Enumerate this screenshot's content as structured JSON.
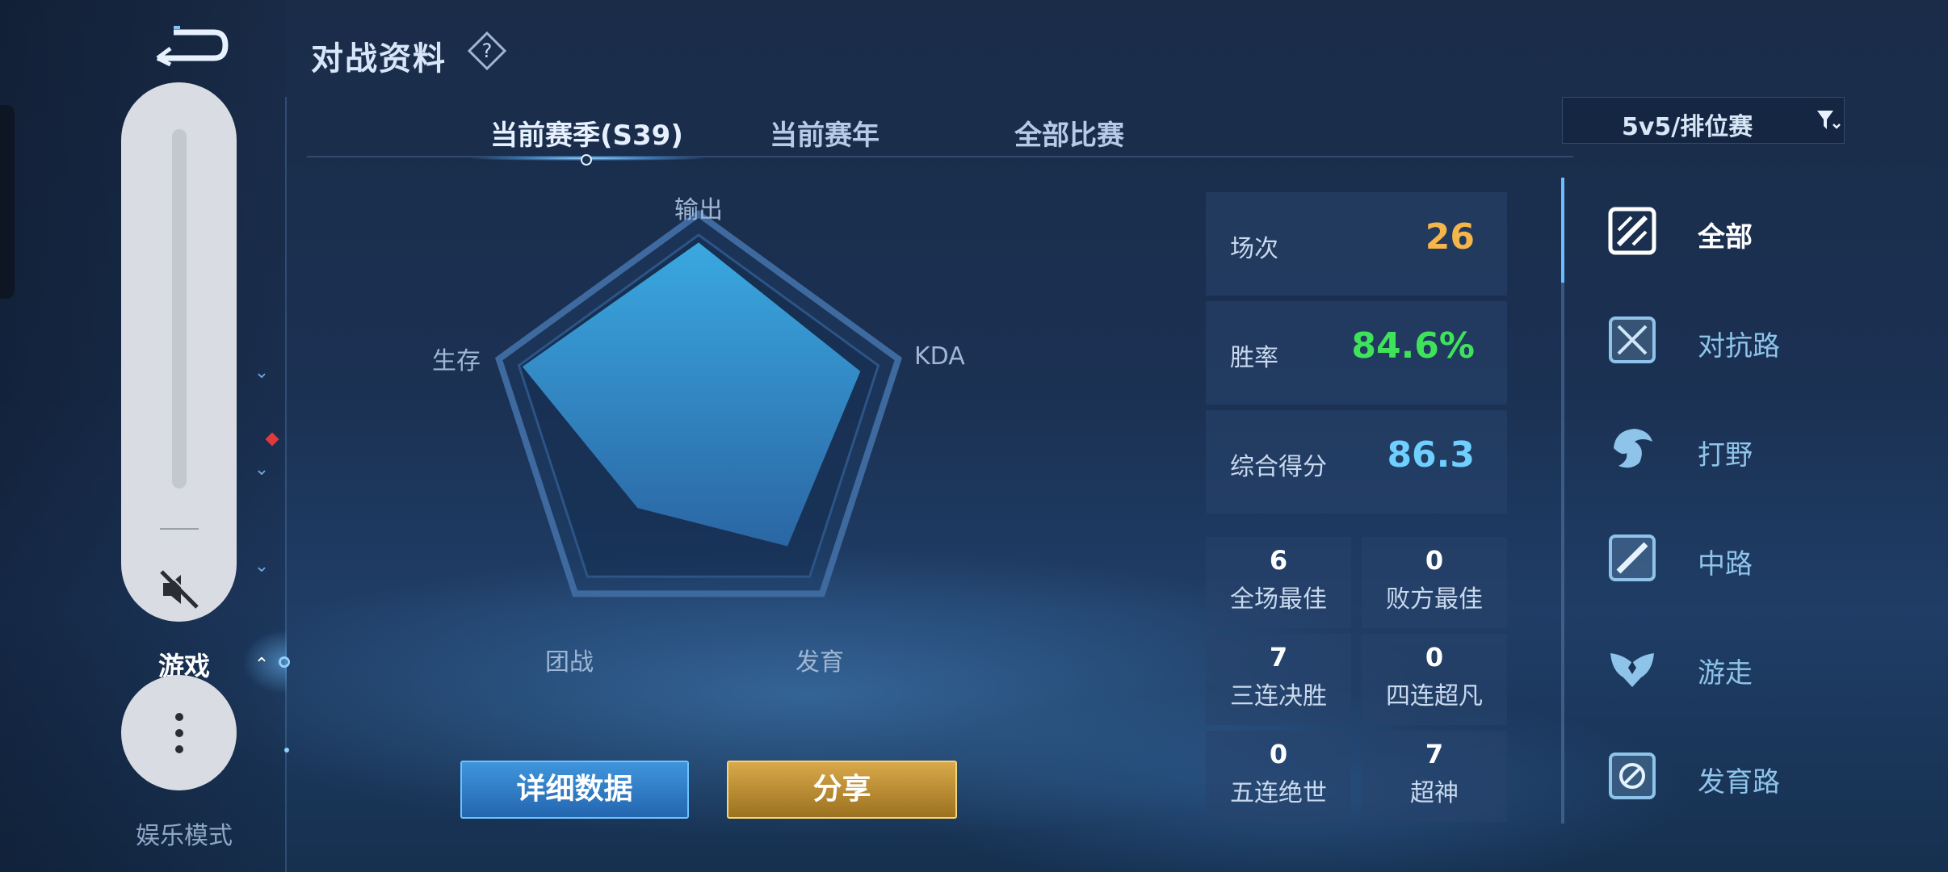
{
  "header": {
    "title": "对战资料"
  },
  "tabs": [
    {
      "label": "当前赛季(S39)",
      "active": true
    },
    {
      "label": "当前赛年",
      "active": false
    },
    {
      "label": "全部比赛",
      "active": false
    }
  ],
  "filter": {
    "selected": "5v5/排位赛"
  },
  "left_nav": {
    "active_label": "游戏",
    "bottom_label": "娱乐模式"
  },
  "radar": {
    "labels": [
      "输出",
      "KDA",
      "发育",
      "团战",
      "生存"
    ],
    "values": [
      0.96,
      0.9,
      0.8,
      0.55,
      0.98
    ]
  },
  "buttons": {
    "detail": "详细数据",
    "share": "分享"
  },
  "stats": {
    "matches": {
      "label": "场次",
      "value": "26",
      "color": "#f4b64a"
    },
    "winrate": {
      "label": "胜率",
      "value": "84.6%",
      "color": "#3fe35a"
    },
    "score": {
      "label": "综合得分",
      "value": "86.3",
      "color": "#6fd0ff"
    }
  },
  "honors": [
    {
      "count": "6",
      "label": "全场最佳"
    },
    {
      "count": "0",
      "label": "败方最佳"
    },
    {
      "count": "7",
      "label": "三连决胜"
    },
    {
      "count": "0",
      "label": "四连超凡"
    },
    {
      "count": "0",
      "label": "五连绝世"
    },
    {
      "count": "7",
      "label": "超神"
    }
  ],
  "roles": [
    {
      "label": "全部",
      "icon": "all-roles-icon",
      "active": true
    },
    {
      "label": "对抗路",
      "icon": "clash-lane-icon",
      "active": false
    },
    {
      "label": "打野",
      "icon": "jungle-icon",
      "active": false
    },
    {
      "label": "中路",
      "icon": "mid-lane-icon",
      "active": false
    },
    {
      "label": "游走",
      "icon": "roam-icon",
      "active": false
    },
    {
      "label": "发育路",
      "icon": "farm-lane-icon",
      "active": false
    }
  ]
}
